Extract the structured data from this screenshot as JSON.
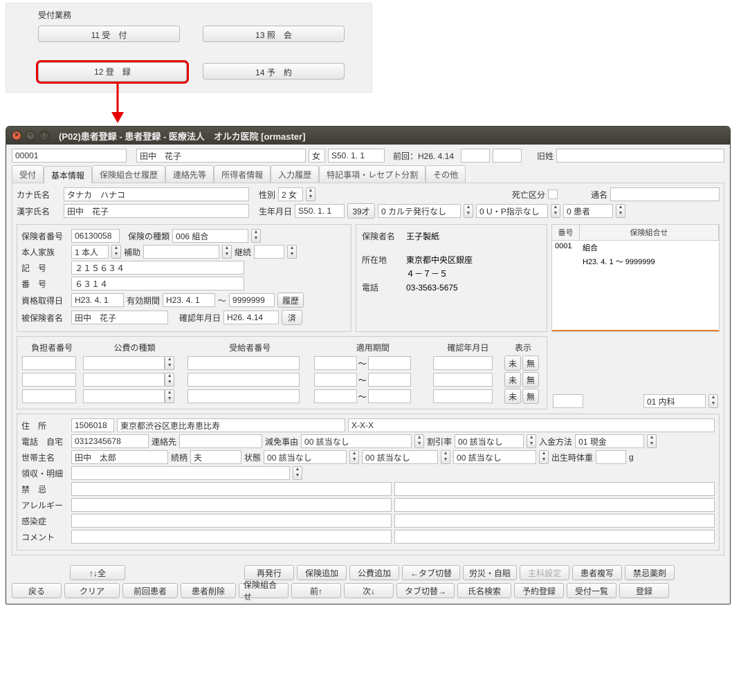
{
  "concept": {
    "title": "受付業務",
    "b11": "11 受　付",
    "b12": "12 登　録",
    "b13": "13 照　会",
    "b14": "14 予　約"
  },
  "window_title": "(P02)患者登録 - 患者登録 - 医療法人　オルカ医院  [ormaster]",
  "hdr": {
    "patient_no": "00001",
    "name": "田中　花子",
    "sex": "女",
    "birth": "S50. 1. 1",
    "prev_label": "前回：H26. 4.14",
    "old_name_label": "旧姓"
  },
  "tabs": [
    "受付",
    "基本情報",
    "保険組合せ履歴",
    "連絡先等",
    "所得者情報",
    "入力履歴",
    "特記事項・レセプト分割",
    "その他"
  ],
  "basic": {
    "kana_label": "カナ氏名",
    "kana": "タナカ　ハナコ",
    "sex_label": "性別",
    "sex": "2 女",
    "death_label": "死亡区分",
    "alias_label": "通名",
    "kanji_label": "漢字氏名",
    "kanji": "田中　花子",
    "birth_label": "生年月日",
    "birth": "S50. 1. 1",
    "age": "39才",
    "chart_issue": "0 カルテ発行なし",
    "up_inst": "0 U・P指示なし",
    "patient_cls": "0 患者"
  },
  "ins": {
    "insurer_no_label": "保険者番号",
    "insurer_no": "06130058",
    "ins_type_label": "保険の種類",
    "ins_type": "006 組合",
    "self_family_label": "本人家族",
    "self_family": "1 本人",
    "assist_label": "補助",
    "cont_label": "継続",
    "symbol_label": "記　号",
    "symbol": "２１５６３４",
    "number_label": "番　号",
    "number": "６３１４",
    "acq_label": "資格取得日",
    "acq": "H23. 4. 1",
    "valid_label": "有効期間",
    "valid_from": "H23. 4. 1",
    "tilde": "～",
    "valid_to": "9999999",
    "hist_btn": "履歴",
    "insured_label": "被保険者名",
    "insured": "田中　花子",
    "confirm_label": "確認年月日",
    "confirm": "H26. 4.14",
    "done_btn": "済",
    "insurer_name_label": "保険者名",
    "insurer_name": "王子製紙",
    "addr_label": "所在地",
    "addr1": "東京都中央区銀座",
    "addr2": "４－７－５",
    "tel_label": "電話",
    "tel": "03-3563-5675"
  },
  "pubexp": {
    "hdrs": [
      "負担者番号",
      "公費の種類",
      "受給者番号",
      "適用期間",
      "確認年月日",
      "表示"
    ],
    "tilde": "～",
    "mi": "未",
    "mu": "無"
  },
  "inslist": {
    "h_no": "番号",
    "h_name": "保険組合せ",
    "row_no": "0001",
    "row_name": "組合",
    "row_period": "H23. 4. 1 ～ 9999999",
    "dept": "01 内科"
  },
  "addr": {
    "addr_label": "住　所",
    "zip": "1506018",
    "addr": "東京都渋谷区恵比寿恵比寿",
    "addr2": "X-X-X",
    "tel_label": "電話　自宅",
    "tel": "0312345678",
    "contact_label": "連絡先",
    "reduce_label": "減免事由",
    "reduce": "00 該当なし",
    "disc_label": "割引率",
    "disc": "00 該当なし",
    "pay_label": "入金方法",
    "pay": "01 現金",
    "head_label": "世帯主名",
    "head": "田中　太郎",
    "relation_label": "続柄",
    "relation": "夫",
    "state_label": "状態",
    "state": "00 該当なし",
    "state2": "00 該当なし",
    "state3": "00 該当なし",
    "bweight_label": "出生時体重",
    "g": "g",
    "receipt_label": "領収・明細",
    "forbidden_label": "禁　忌",
    "allergy_label": "アレルギー",
    "infect_label": "感染症",
    "comment_label": "コメント"
  },
  "foot": {
    "r1": [
      "↑↓全",
      "",
      "",
      "再発行",
      "保険追加",
      "公費追加",
      "←タブ切替",
      "労災・自賠",
      "主科設定",
      "患者複写",
      "禁忌薬剤"
    ],
    "r2": [
      "戻る",
      "クリア",
      "前回患者",
      "患者削除",
      "保険組合せ",
      "前↑",
      "次↓",
      "タブ切替→",
      "氏名検索",
      "予約登録",
      "受付一覧",
      "登録"
    ]
  }
}
